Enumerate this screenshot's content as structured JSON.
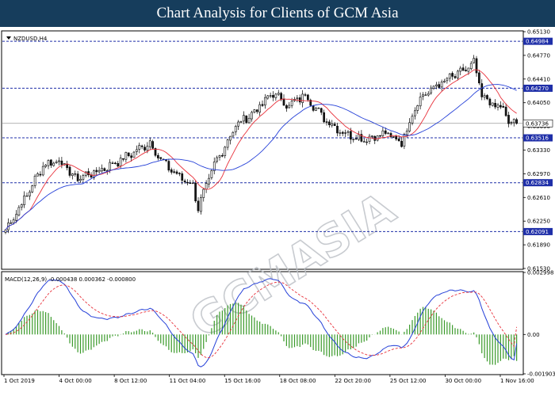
{
  "title": "Chart Analysis for Clients of GCM Asia",
  "colors": {
    "title_bg": "#163d5c",
    "bull_candle": "#1a1a1a",
    "bear_candle": "#1a1a1a",
    "ma_fast": "#e8303a",
    "ma_slow": "#2540d8",
    "level_line": "#1f2fa8",
    "macd_signal": "#e8303a",
    "macd_line": "#2540d8",
    "histogram": "#3a9a2a",
    "watermark": "#bfc3c8"
  },
  "watermark": "GCMASIA",
  "chart_data": [
    {
      "type": "candlestick",
      "symbol": "NZDUSD,H4",
      "ylim": [
        0.6153,
        0.6513
      ],
      "y_ticks": [
        0.6513,
        0.6477,
        0.6441,
        0.6405,
        0.6369,
        0.6333,
        0.6297,
        0.6261,
        0.6225,
        0.6189,
        0.6153
      ],
      "y_tick_labels": [
        "0.65130",
        "0.64770",
        "0.64410",
        "0.64050",
        "0.63690",
        "0.63330",
        "0.62970",
        "0.62610",
        "0.62250",
        "0.61890",
        "0.61530"
      ],
      "x_labels": [
        "1 Oct 2019",
        "4 Oct 00:00",
        "8 Oct 12:00",
        "11 Oct 04:00",
        "15 Oct 16:00",
        "18 Oct 08:00",
        "22 Oct 20:00",
        "25 Oct 12:00",
        "30 Oct 00:00",
        "1 Nov 16:00"
      ],
      "current_price": 0.63736,
      "current_price_label": "0.63736",
      "levels": [
        {
          "value": 0.64984,
          "label": "0.64984"
        },
        {
          "value": 0.6427,
          "label": "0.64270"
        },
        {
          "value": 0.63516,
          "label": "0.63516"
        },
        {
          "value": 0.62834,
          "label": "0.62834"
        },
        {
          "value": 0.62091,
          "label": "0.62091"
        }
      ],
      "anchor_closes": [
        [
          0,
          0.6212
        ],
        [
          8,
          0.6265
        ],
        [
          14,
          0.631
        ],
        [
          20,
          0.6318
        ],
        [
          26,
          0.629
        ],
        [
          34,
          0.63
        ],
        [
          44,
          0.632
        ],
        [
          54,
          0.6345
        ],
        [
          58,
          0.6318
        ],
        [
          64,
          0.6295
        ],
        [
          70,
          0.628
        ],
        [
          72,
          0.6245
        ],
        [
          78,
          0.631
        ],
        [
          86,
          0.637
        ],
        [
          94,
          0.6395
        ],
        [
          100,
          0.642
        ],
        [
          106,
          0.64
        ],
        [
          112,
          0.6418
        ],
        [
          118,
          0.6385
        ],
        [
          126,
          0.636
        ],
        [
          134,
          0.635
        ],
        [
          142,
          0.6358
        ],
        [
          148,
          0.6345
        ],
        [
          154,
          0.6408
        ],
        [
          160,
          0.6428
        ],
        [
          166,
          0.6442
        ],
        [
          172,
          0.6455
        ],
        [
          175,
          0.6465
        ],
        [
          178,
          0.6415
        ],
        [
          182,
          0.6402
        ],
        [
          186,
          0.6395
        ],
        [
          188,
          0.6375
        ],
        [
          190,
          0.6373
        ]
      ]
    },
    {
      "type": "macd",
      "label": "MACD(12,26,9) -0.000438 0.000362 -0.000800",
      "ylim": [
        -0.001903,
        0.002998
      ],
      "y_tick_labels": [
        "0.002998",
        "0.00",
        "-0.001903"
      ],
      "y_ticks": [
        0.002998,
        0.0,
        -0.001903
      ]
    }
  ]
}
